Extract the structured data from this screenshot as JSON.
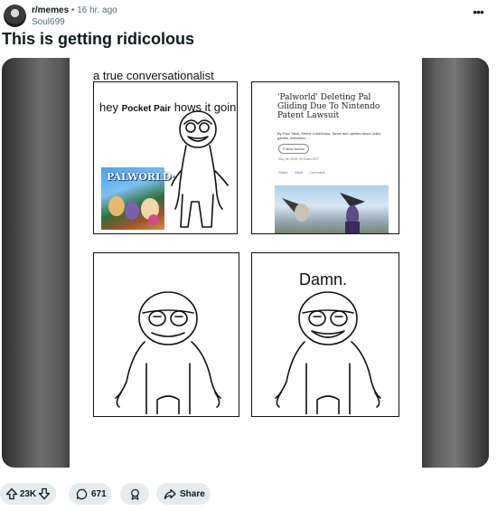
{
  "post": {
    "subreddit": "r/memes",
    "separator": "•",
    "time": "16 hr. ago",
    "author": "Soul699",
    "title": "This is getting ridicolous"
  },
  "comic": {
    "caption": "a true conversationalist",
    "panel1": {
      "speech_pre": "hey",
      "speech_name": "Pocket Pair",
      "speech_post": "hows it goin?",
      "game_logo": "PALWORLD:"
    },
    "panel2": {
      "headline": "'Palworld' Deleting Pal Gliding Due To Nintendo Patent Lawsuit",
      "byline": "By Paul Tassi, Senior Contributor. News and opinion about video games, television,...",
      "follow_label": "Follow Author",
      "date": "May 08, 2025, 09:00am EDT",
      "share_label": "Share",
      "save_label": "Save",
      "comment_label": "Comment"
    },
    "panel4": {
      "speech": "Damn."
    }
  },
  "actions": {
    "upvotes": "23K",
    "comments": "671",
    "share_label": "Share"
  },
  "colors": {
    "pill_bg": "#e5ebee",
    "text_primary": "#0f1a1c",
    "text_meta": "#576f76"
  },
  "icons": {
    "more": "more-horizontal-icon",
    "upvote": "upvote-arrow-icon",
    "downvote": "downvote-arrow-icon",
    "comment": "comment-bubble-icon",
    "award": "award-icon",
    "share": "share-arrow-icon"
  }
}
